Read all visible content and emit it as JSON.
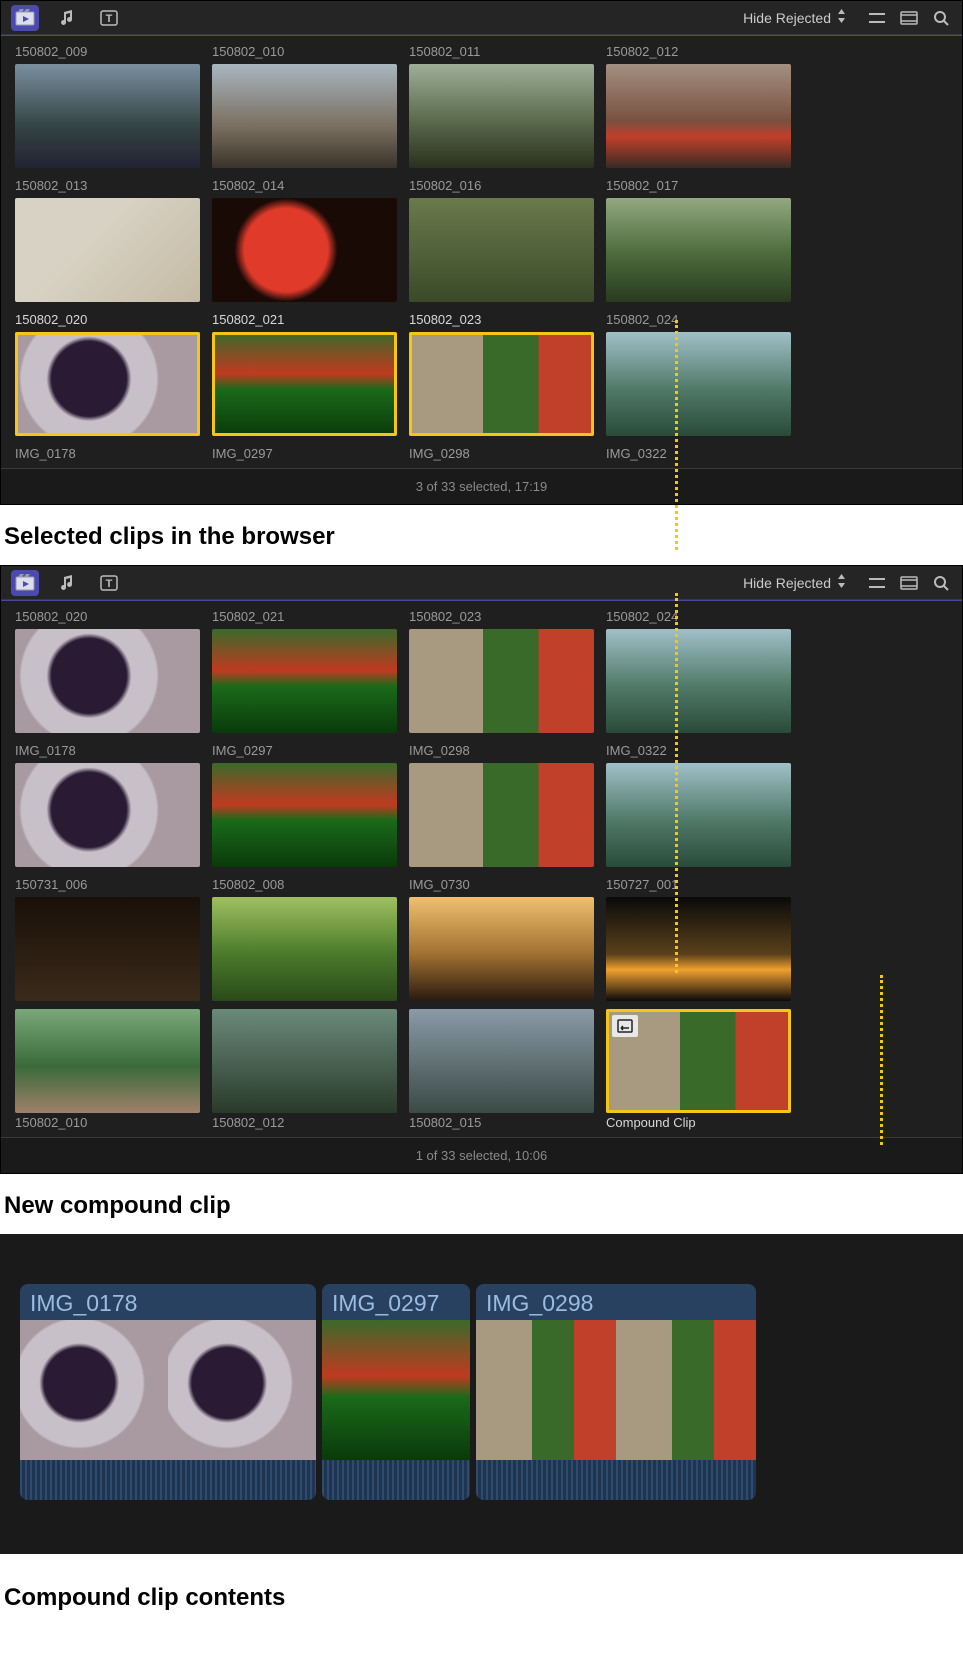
{
  "toolbar": {
    "filter_label": "Hide Rejected"
  },
  "panel1": {
    "clips": [
      {
        "label": "150802_009",
        "g": "g1",
        "sel": false
      },
      {
        "label": "150802_010",
        "g": "g2",
        "sel": false
      },
      {
        "label": "150802_011",
        "g": "g3",
        "sel": false
      },
      {
        "label": "150802_012",
        "g": "g4",
        "sel": false
      },
      {
        "label": "150802_013",
        "g": "g5",
        "sel": false
      },
      {
        "label": "150802_014",
        "g": "g6",
        "sel": false
      },
      {
        "label": "150802_016",
        "g": "g7",
        "sel": false
      },
      {
        "label": "150802_017",
        "g": "g8",
        "sel": false
      },
      {
        "label": "150802_020",
        "g": "g9",
        "sel": true
      },
      {
        "label": "150802_021",
        "g": "g10",
        "sel": true
      },
      {
        "label": "150802_023",
        "g": "g11",
        "sel": true
      },
      {
        "label": "150802_024",
        "g": "g12",
        "sel": false
      },
      {
        "label": "IMG_0178",
        "g": "",
        "sel": false,
        "hidden": true
      },
      {
        "label": "IMG_0297",
        "g": "",
        "sel": false,
        "hidden": true
      },
      {
        "label": "IMG_0298",
        "g": "",
        "sel": false,
        "hidden": true
      },
      {
        "label": "IMG_0322",
        "g": "",
        "sel": false,
        "hidden": true
      }
    ],
    "status": "3 of 33 selected, 17:19"
  },
  "caption1": "Selected clips in the browser",
  "panel2": {
    "clips": [
      {
        "label": "150802_020",
        "g": "g9",
        "sel": false
      },
      {
        "label": "150802_021",
        "g": "g10",
        "sel": false
      },
      {
        "label": "150802_023",
        "g": "g11",
        "sel": false
      },
      {
        "label": "150802_024",
        "g": "g12",
        "sel": false
      },
      {
        "label": "IMG_0178",
        "g": "g9",
        "sel": false
      },
      {
        "label": "IMG_0297",
        "g": "g10",
        "sel": false
      },
      {
        "label": "IMG_0298",
        "g": "g11",
        "sel": false
      },
      {
        "label": "IMG_0322",
        "g": "g12",
        "sel": false
      },
      {
        "label": "150731_006",
        "g": "g13",
        "sel": false
      },
      {
        "label": "150802_008",
        "g": "g14",
        "sel": false
      },
      {
        "label": "IMG_0730",
        "g": "g15",
        "sel": false
      },
      {
        "label": "150727_001",
        "g": "g16",
        "sel": false
      },
      {
        "label": "150802_010",
        "g": "g17",
        "sel": false
      },
      {
        "label": "150802_012",
        "g": "g18",
        "sel": false
      },
      {
        "label": "150802_015",
        "g": "g19",
        "sel": false
      },
      {
        "label": "Compound Clip",
        "g": "g11",
        "sel": true,
        "compound": true
      }
    ],
    "status": "1 of 33 selected, 10:06"
  },
  "caption2": "New compound clip",
  "timeline": {
    "clips": [
      {
        "label": "IMG_0178"
      },
      {
        "label": "IMG_0297"
      },
      {
        "label": "IMG_0298"
      }
    ]
  },
  "caption3": "Compound clip contents"
}
